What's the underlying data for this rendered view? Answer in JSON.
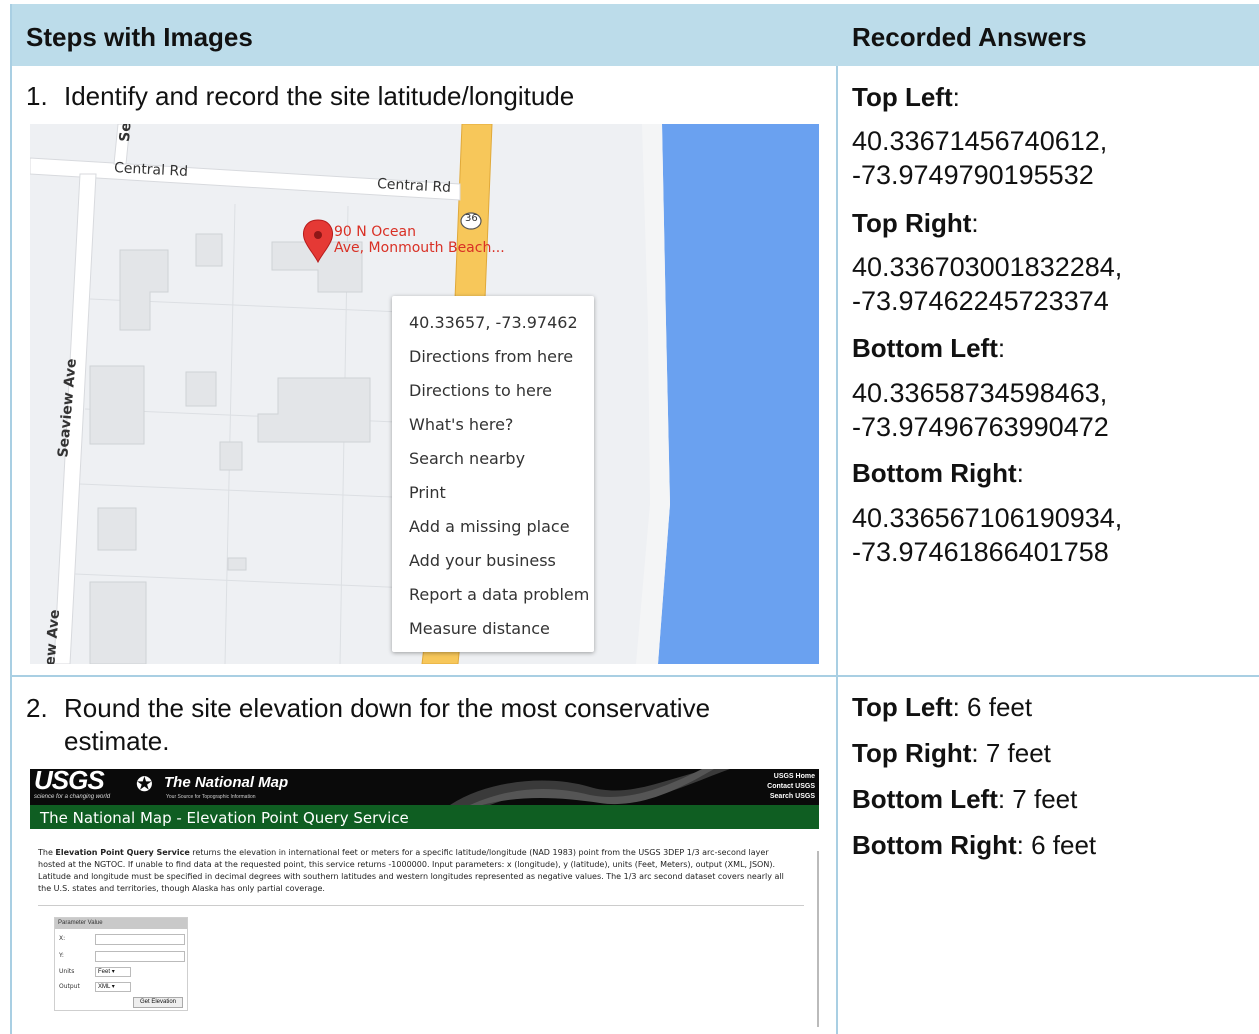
{
  "header": {
    "col1": "Steps with Images",
    "col2": "Recorded Answers"
  },
  "step1": {
    "num": "1.",
    "text": "Identify and record the site latitude/longitude",
    "map": {
      "roads": [
        "Central Rd",
        "Central Rd",
        "Seaview Ave",
        "iew Ave",
        "Se"
      ],
      "route_badge": "36",
      "pin_label_line1": "90 N Ocean",
      "pin_label_line2": "Ave, Monmouth Beach...",
      "menu": [
        "40.33657, -73.97462",
        "Directions from here",
        "Directions to here",
        "What's here?",
        "Search nearby",
        "Print",
        "Add a missing place",
        "Add your business",
        "Report a data problem",
        "Measure distance"
      ]
    },
    "answers": [
      {
        "label": "Top Left",
        "lines": [
          "40.33671456740612,",
          "-73.9749790195532"
        ]
      },
      {
        "label": "Top Right",
        "lines": [
          "40.336703001832284,",
          "-73.97462245723374"
        ]
      },
      {
        "label": "Bottom Left",
        "lines": [
          "40.33658734598463,",
          "-73.97496763990472"
        ]
      },
      {
        "label": "Bottom Right",
        "lines": [
          "40.336567106190934,",
          "-73.97461866401758"
        ]
      }
    ]
  },
  "step2": {
    "num": "2.",
    "text_line1": "Round the site elevation down for the most conservative",
    "text_line2": "estimate.",
    "usgs": {
      "logo": "USGS",
      "logo_tag": "science for a changing world",
      "brand": "The National Map",
      "brand_tag": "Your Source for Topographic Information",
      "links": [
        "USGS Home",
        "Contact USGS",
        "Search USGS"
      ],
      "bar_title": "The National Map - Elevation Point Query Service",
      "para_bold": "Elevation Point Query Service",
      "para_start": "The ",
      "para_rest": " returns the elevation in international feet or meters for a specific latitude/longitude (NAD 1983) point from the USGS 3DEP 1/3 arc-second layer hosted at the NGTOC. If unable to find data at the requested point, this service returns -1000000. Input parameters: x (longitude), y (latitude), units (Feet, Meters), output (XML, JSON). Latitude and longitude must be specified in decimal degrees with southern latitudes and western longitudes represented as negative values. The 1/3 arc second dataset covers nearly all the U.S. states and territories, though Alaska has only partial coverage.",
      "form": {
        "head": "Parameter  Value",
        "x_label": "X:",
        "y_label": "Y:",
        "units_label": "Units",
        "units_value": "Feet",
        "output_label": "Output",
        "output_value": "XML",
        "button": "Get Elevation"
      }
    },
    "answers": [
      {
        "label": "Top Left",
        "value": ": 6 feet"
      },
      {
        "label": "Top Right",
        "value": ": 7 feet"
      },
      {
        "label": "Bottom Left",
        "value": ": 7 feet"
      },
      {
        "label": "Bottom Right",
        "value": ": 6 feet"
      }
    ]
  },
  "colors": {
    "header_bg": "#bcdcea",
    "grid": "#a9cfe3",
    "pin": "#e53935",
    "water": "#6aa1f0",
    "road": "#f7c75a",
    "usgs_green": "#0f5e22"
  }
}
